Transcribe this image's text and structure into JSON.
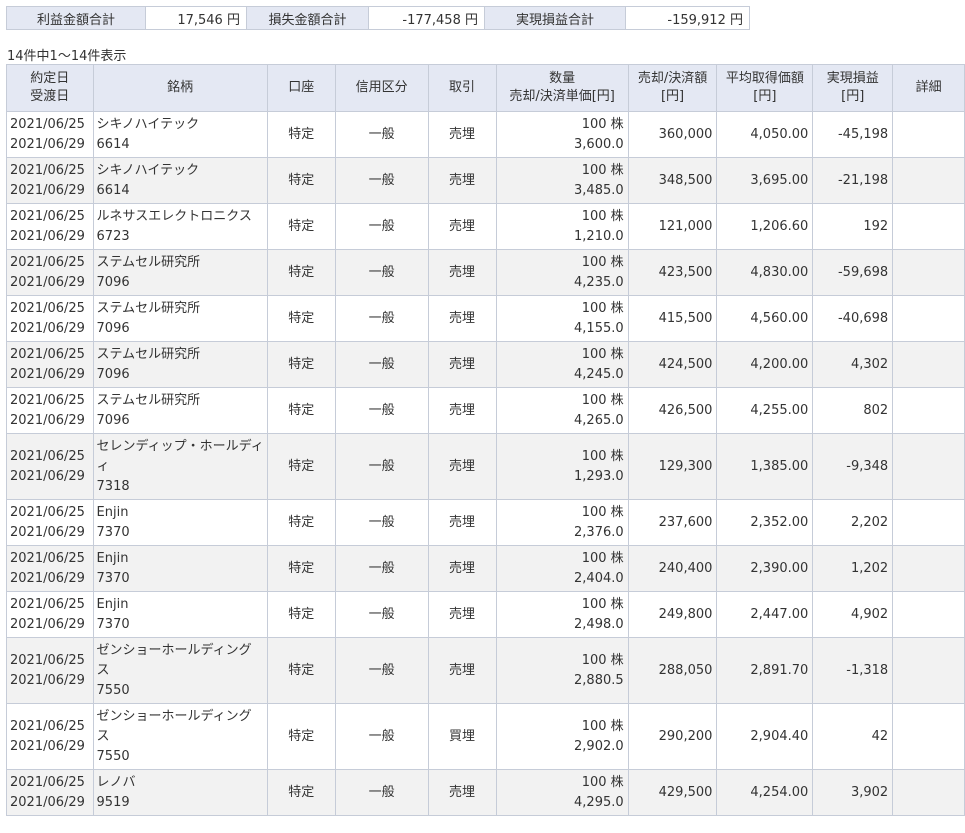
{
  "summary": {
    "profit_total_label": "利益金額合計",
    "profit_total_value": "17,546",
    "loss_total_label": "損失金額合計",
    "loss_total_value": "-177,458",
    "realized_total_label": "実現損益合計",
    "realized_total_value": "-159,912",
    "unit": "円"
  },
  "count_text": "14件中1～14件表示",
  "table": {
    "headers": {
      "date_l1": "約定日",
      "date_l2": "受渡日",
      "name": "銘柄",
      "account": "口座",
      "credit": "信用区分",
      "trade": "取引",
      "qty_l1": "数量",
      "qty_l2": "売却/決済単価[円]",
      "amount_l1": "売却/決済額",
      "amount_l2": "[円]",
      "avg_l1": "平均取得価額",
      "avg_l2": "[円]",
      "pl_l1": "実現損益",
      "pl_l2": "[円]",
      "detail": "詳細"
    },
    "rows": [
      {
        "trade_date": "2021/06/25",
        "settle_date": "2021/06/29",
        "name": "シキノハイテック",
        "code": "6614",
        "account": "特定",
        "credit": "一般",
        "trade": "売埋",
        "qty": "100 株",
        "price": "3,600.0",
        "amount": "360,000",
        "avg_cost": "4,050.00",
        "pl": "-45,198"
      },
      {
        "trade_date": "2021/06/25",
        "settle_date": "2021/06/29",
        "name": "シキノハイテック",
        "code": "6614",
        "account": "特定",
        "credit": "一般",
        "trade": "売埋",
        "qty": "100 株",
        "price": "3,485.0",
        "amount": "348,500",
        "avg_cost": "3,695.00",
        "pl": "-21,198"
      },
      {
        "trade_date": "2021/06/25",
        "settle_date": "2021/06/29",
        "name": "ルネサスエレクトロニクス",
        "code": "6723",
        "account": "特定",
        "credit": "一般",
        "trade": "売埋",
        "qty": "100 株",
        "price": "1,210.0",
        "amount": "121,000",
        "avg_cost": "1,206.60",
        "pl": "192"
      },
      {
        "trade_date": "2021/06/25",
        "settle_date": "2021/06/29",
        "name": "ステムセル研究所",
        "code": "7096",
        "account": "特定",
        "credit": "一般",
        "trade": "売埋",
        "qty": "100 株",
        "price": "4,235.0",
        "amount": "423,500",
        "avg_cost": "4,830.00",
        "pl": "-59,698"
      },
      {
        "trade_date": "2021/06/25",
        "settle_date": "2021/06/29",
        "name": "ステムセル研究所",
        "code": "7096",
        "account": "特定",
        "credit": "一般",
        "trade": "売埋",
        "qty": "100 株",
        "price": "4,155.0",
        "amount": "415,500",
        "avg_cost": "4,560.00",
        "pl": "-40,698"
      },
      {
        "trade_date": "2021/06/25",
        "settle_date": "2021/06/29",
        "name": "ステムセル研究所",
        "code": "7096",
        "account": "特定",
        "credit": "一般",
        "trade": "売埋",
        "qty": "100 株",
        "price": "4,245.0",
        "amount": "424,500",
        "avg_cost": "4,200.00",
        "pl": "4,302"
      },
      {
        "trade_date": "2021/06/25",
        "settle_date": "2021/06/29",
        "name": "ステムセル研究所",
        "code": "7096",
        "account": "特定",
        "credit": "一般",
        "trade": "売埋",
        "qty": "100 株",
        "price": "4,265.0",
        "amount": "426,500",
        "avg_cost": "4,255.00",
        "pl": "802"
      },
      {
        "trade_date": "2021/06/25",
        "settle_date": "2021/06/29",
        "name": "セレンディップ・ホールディ",
        "name2": "ィ",
        "code": "7318",
        "account": "特定",
        "credit": "一般",
        "trade": "売埋",
        "qty": "100 株",
        "price": "1,293.0",
        "amount": "129,300",
        "avg_cost": "1,385.00",
        "pl": "-9,348"
      },
      {
        "trade_date": "2021/06/25",
        "settle_date": "2021/06/29",
        "name": "Enjin",
        "code": "7370",
        "account": "特定",
        "credit": "一般",
        "trade": "売埋",
        "qty": "100 株",
        "price": "2,376.0",
        "amount": "237,600",
        "avg_cost": "2,352.00",
        "pl": "2,202"
      },
      {
        "trade_date": "2021/06/25",
        "settle_date": "2021/06/29",
        "name": "Enjin",
        "code": "7370",
        "account": "特定",
        "credit": "一般",
        "trade": "売埋",
        "qty": "100 株",
        "price": "2,404.0",
        "amount": "240,400",
        "avg_cost": "2,390.00",
        "pl": "1,202"
      },
      {
        "trade_date": "2021/06/25",
        "settle_date": "2021/06/29",
        "name": "Enjin",
        "code": "7370",
        "account": "特定",
        "credit": "一般",
        "trade": "売埋",
        "qty": "100 株",
        "price": "2,498.0",
        "amount": "249,800",
        "avg_cost": "2,447.00",
        "pl": "4,902"
      },
      {
        "trade_date": "2021/06/25",
        "settle_date": "2021/06/29",
        "name": "ゼンショーホールディング",
        "name2": "ス",
        "code": "7550",
        "account": "特定",
        "credit": "一般",
        "trade": "売埋",
        "qty": "100 株",
        "price": "2,880.5",
        "amount": "288,050",
        "avg_cost": "2,891.70",
        "pl": "-1,318"
      },
      {
        "trade_date": "2021/06/25",
        "settle_date": "2021/06/29",
        "name": "ゼンショーホールディング",
        "name2": "ス",
        "code": "7550",
        "account": "特定",
        "credit": "一般",
        "trade": "買埋",
        "qty": "100 株",
        "price": "2,902.0",
        "amount": "290,200",
        "avg_cost": "2,904.40",
        "pl": "42"
      },
      {
        "trade_date": "2021/06/25",
        "settle_date": "2021/06/29",
        "name": "レノバ",
        "code": "9519",
        "account": "特定",
        "credit": "一般",
        "trade": "売埋",
        "qty": "100 株",
        "price": "4,295.0",
        "amount": "429,500",
        "avg_cost": "4,254.00",
        "pl": "3,902"
      }
    ]
  }
}
